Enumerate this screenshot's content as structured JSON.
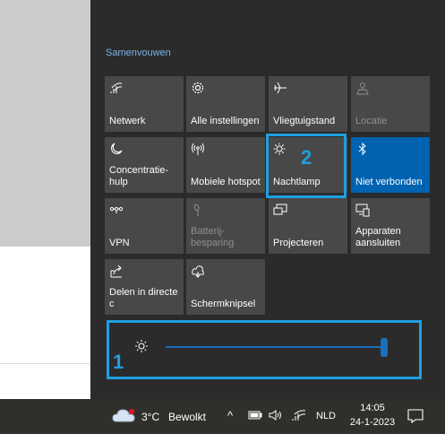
{
  "action_center": {
    "collapse_label": "Samenvouwen",
    "tiles": [
      {
        "label": "Netwerk",
        "icon": "network-icon"
      },
      {
        "label": "Alle instellingen",
        "icon": "gear-icon"
      },
      {
        "label": "Vliegtuigstand",
        "icon": "airplane-icon"
      },
      {
        "label": "Locatie",
        "icon": "location-icon"
      },
      {
        "label": "Concentratie-hulp",
        "icon": "moon-icon"
      },
      {
        "label": "Mobiele hotspot",
        "icon": "hotspot-icon"
      },
      {
        "label": "Nachtlamp",
        "icon": "sun-icon"
      },
      {
        "label": "Niet verbonden",
        "icon": "bluetooth-icon"
      },
      {
        "label": "VPN",
        "icon": "vpn-icon"
      },
      {
        "label": "Batterij-besparing",
        "icon": "battery-saver-icon"
      },
      {
        "label": "Projecteren",
        "icon": "project-icon"
      },
      {
        "label": "Apparaten aansluiten",
        "icon": "connect-icon"
      },
      {
        "label": "Delen in directe c",
        "icon": "share-icon"
      },
      {
        "label": "Schermknipsel",
        "icon": "snip-icon"
      }
    ],
    "brightness": {
      "level": 1.0,
      "icon": "sun-icon"
    },
    "annotations": {
      "slider_number": "1",
      "nightlight_number": "2"
    },
    "accent_color": "#0063b1",
    "annotation_color": "#1ea0e0"
  },
  "taskbar": {
    "weather_temp": "3°C",
    "weather_text": "Bewolkt",
    "language": "NLD",
    "time": "14:05",
    "date": "24-1-2023"
  }
}
